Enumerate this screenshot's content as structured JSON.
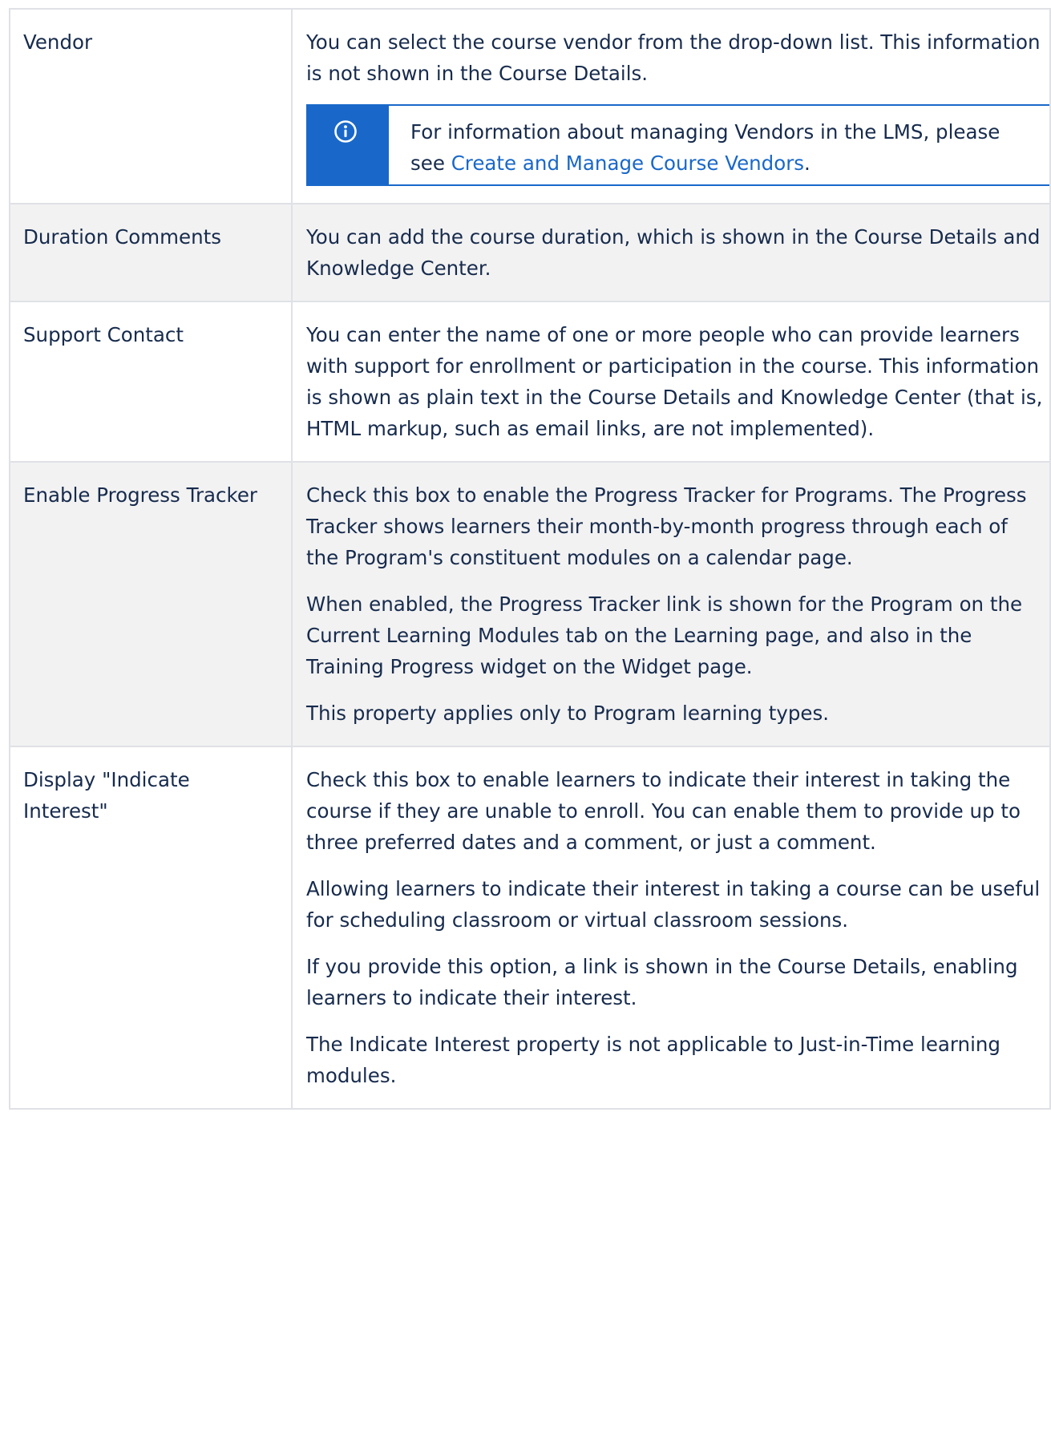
{
  "rows": [
    {
      "property": "Vendor",
      "paragraphs": [
        "You can select the course vendor from the drop-down list. This information is not shown in the Course Details."
      ],
      "note": {
        "icon": "info-icon",
        "text_before": "For information about managing Vendors in the LMS, please see ",
        "link_text": "Create and Manage Course Vendors",
        "text_after": "."
      }
    },
    {
      "property": "Duration Comments",
      "paragraphs": [
        "You can add the course duration, which is shown in the Course Details and Knowledge Center."
      ]
    },
    {
      "property": "Support Contact",
      "paragraphs": [
        "You can enter the name of one or more people who can provide learners with support for enrollment or participation in the course. This information is shown as plain text in the Course Details and Knowledge Center (that is, HTML markup, such as email links, are not implemented)."
      ]
    },
    {
      "property": "Enable Progress Tracker",
      "paragraphs": [
        "Check this box to enable the Progress Tracker for Programs. The Progress Tracker shows learners their month-by-month progress through each of the Program's constituent modules on a calendar page.",
        "When enabled, the Progress Tracker link is shown for the Program on the Current Learning Modules tab on the Learning page, and also in the Training Progress widget on the Widget page.",
        "This property applies only to Program learning types."
      ]
    },
    {
      "property": "Display \"Indicate Interest\"",
      "paragraphs": [
        "Check this box to enable learners to indicate their interest in taking the course if they are unable to enroll. You can enable them to provide up to three preferred dates and a comment, or just a comment.",
        "Allowing learners to indicate their interest in taking a course can be useful for scheduling classroom or virtual classroom sessions.",
        "If you provide this option, a link is shown in the Course Details, enabling learners to indicate their interest.",
        "The Indicate Interest property is not applicable to Just-in-Time learning modules."
      ]
    }
  ],
  "colors": {
    "text": "#172b4d",
    "link": "#1968c9",
    "note_accent": "#1968c9",
    "row_shade": "#f2f2f2",
    "border": "#dfe1e6"
  }
}
